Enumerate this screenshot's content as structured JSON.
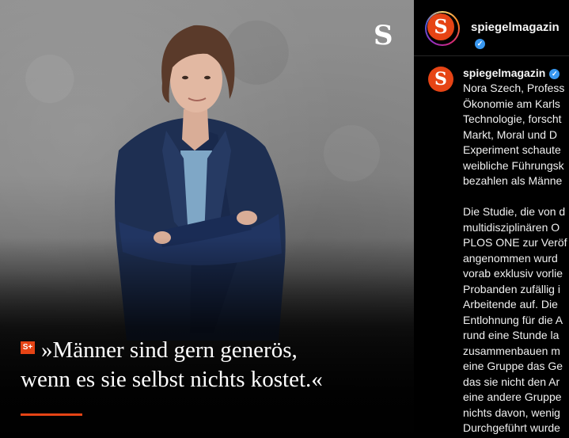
{
  "post": {
    "brand_mark": "S",
    "badge": "S+",
    "quote_line_1": "»Männer sind gern generös,",
    "quote_line_2": "wenn es sie selbst nichts kostet.«",
    "accent_color": "#e64415"
  },
  "header": {
    "username": "spiegelmagazin",
    "avatar_letter": "S",
    "verified_icon": "verified-badge-icon"
  },
  "caption": {
    "username": "spiegelmagazin",
    "avatar_letter": "S",
    "lines": [
      "Nora Szech, Profess",
      "Ökonomie am Karls",
      "Technologie, forscht",
      "Markt, Moral und D",
      "Experiment schaute",
      "weibliche Führungsk",
      "bezahlen als Männe",
      "",
      "Die Studie, die von d",
      "multidisziplinären O",
      "PLOS ONE zur Veröf",
      "angenommen wurd",
      "vorab exklusiv vorlie",
      "Probanden zufällig i",
      "Arbeitende auf. Die",
      "Entlohnung für die A",
      "rund eine Stunde la",
      "zusammenbauen m",
      "eine Gruppe das Ge",
      "das sie nicht den Ar",
      "eine andere Gruppe",
      "nichts davon, wenig",
      "Durchgeführt wurde"
    ]
  }
}
